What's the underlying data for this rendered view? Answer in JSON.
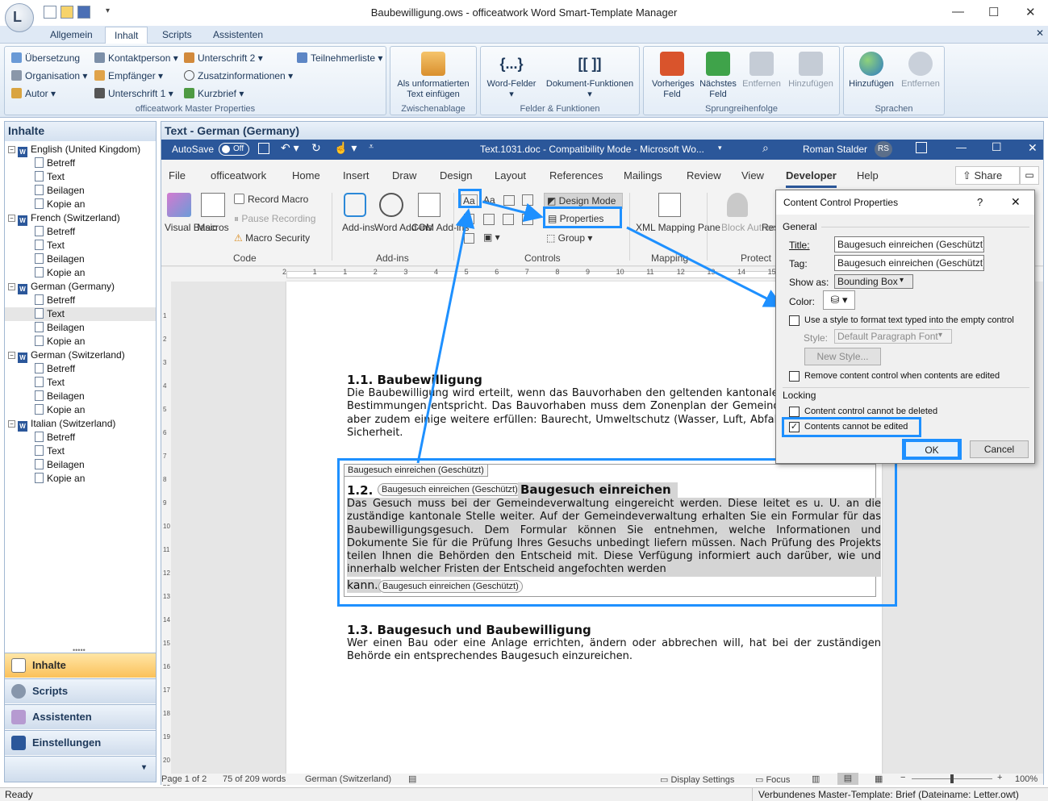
{
  "window": {
    "title": "Baubewilligung.ows - officeatwork Word Smart-Template Manager",
    "app_logo": "L"
  },
  "tabs": [
    "Allgemein",
    "Inhalt",
    "Scripts",
    "Assistenten"
  ],
  "ribbon": {
    "master_properties": {
      "items": [
        "Übersetzung",
        "Kontaktperson",
        "Unterschrift 2",
        "Teilnehmerliste",
        "Organisation",
        "Empfänger",
        "Zusatzinformationen",
        "Autor",
        "Unterschrift 1",
        "Kurzbrief"
      ],
      "label": "officeatwork Master Properties"
    },
    "clipboard": {
      "button": "Als unformatierten Text einfügen",
      "label": "Zwischenablage"
    },
    "fields": {
      "word_fields": "Word-Felder",
      "doc_functions": "Dokument-Funktionen",
      "label": "Felder & Funktionen",
      "word_fields_icon": "{...}",
      "doc_functions_icon": "[[ ]]"
    },
    "jumps": {
      "prev": "Vorheriges Feld",
      "next": "Nächstes Feld",
      "remove": "Entfernen",
      "add": "Hinzufügen",
      "label": "Sprungreihenfolge"
    },
    "languages": {
      "add": "Hinzufügen",
      "remove": "Entfernen",
      "label": "Sprachen"
    }
  },
  "left_panel": {
    "title": "Inhalte",
    "tree": [
      {
        "label": "English (United Kingdom)",
        "children": [
          "Betreff",
          "Text",
          "Beilagen",
          "Kopie an"
        ]
      },
      {
        "label": "French (Switzerland)",
        "children": [
          "Betreff",
          "Text",
          "Beilagen",
          "Kopie an"
        ]
      },
      {
        "label": "German (Germany)",
        "children": [
          "Betreff",
          "Text",
          "Beilagen",
          "Kopie an"
        ]
      },
      {
        "label": "German (Switzerland)",
        "children": [
          "Betreff",
          "Text",
          "Beilagen",
          "Kopie an"
        ]
      },
      {
        "label": "Italian (Switzerland)",
        "children": [
          "Betreff",
          "Text",
          "Beilagen",
          "Kopie an"
        ]
      }
    ],
    "nav": [
      "Inhalte",
      "Scripts",
      "Assistenten",
      "Einstellungen"
    ]
  },
  "word": {
    "header": "Text - German (Germany)",
    "autosave": "AutoSave",
    "autosave_state": "Off",
    "doc_title": "Text.1031.doc  -  Compatibility Mode  -  Microsoft Wo...",
    "user": "Roman Stalder",
    "user_initials": "RS",
    "menu": [
      "File",
      "officeatwork",
      "Home",
      "Insert",
      "Draw",
      "Design",
      "Layout",
      "References",
      "Mailings",
      "Review",
      "View",
      "Developer",
      "Help"
    ],
    "share": "Share",
    "ribbon": {
      "visual_basic": "Visual Basic",
      "macros": "Macros",
      "record_macro": "Record Macro",
      "pause_recording": "Pause Recording",
      "macro_security": "Macro Security",
      "code_label": "Code",
      "addins": "Add-ins",
      "word_addins": "Word Add-ins",
      "com_addins": "COM Add-ins",
      "addins_label": "Add-ins",
      "design_mode": "Design Mode",
      "properties": "Properties",
      "group": "Group",
      "controls_label": "Controls",
      "xml_pane": "XML Mapping Pane",
      "mapping_label": "Mapping",
      "block_authors": "Block Authors",
      "restrict": "Res Edi",
      "protect_label": "Protect",
      "cc_aa_1": "Aa",
      "cc_aa_2": "Aa"
    },
    "ruler_numbers": [
      "2",
      "1",
      "1",
      "2",
      "3",
      "4",
      "5",
      "6",
      "7",
      "8",
      "9",
      "10",
      "11",
      "12",
      "13",
      "14",
      "15",
      "16",
      "17",
      "18"
    ],
    "vruler_numbers": [
      "1",
      "2",
      "3",
      "4",
      "5",
      "6",
      "7",
      "8",
      "9",
      "10",
      "11",
      "12",
      "13",
      "14",
      "15",
      "16",
      "17",
      "18",
      "19",
      "20",
      "21"
    ],
    "document": {
      "h1": "1.1. Baubewilligung",
      "p1": "Die Baubewilligung wird erteilt, wenn das Bauvorhaben den geltenden kantonalen und kommunalen Bestimmungen entspricht. Das Bauvorhaben muss dem Zonenplan der Gemeinde entsprechen, hat aber zudem einige weitere erfüllen: Baurecht, Umweltschutz (Wasser, Luft, Abfall, Lärm), öffentliche Sicherheit.",
      "cc_tag": "Baugesuch einreichen (Geschützt)",
      "h2_num": "1.2.",
      "h2_text": "Baugesuch einreichen",
      "p2": "Das Gesuch muss bei der Gemeindeverwaltung eingereicht werden. Diese leitet es u. U. an die zuständige kantonale Stelle weiter. Auf der Gemeindeverwaltung erhalten Sie ein Formular für das Baubewilligungsgesuch. Dem Formular können Sie entnehmen, welche Informationen und Dokumente Sie für die Prüfung Ihres Gesuchs unbedingt liefern müssen. Nach Prüfung des Projekts teilen Ihnen die Behörden den Entscheid mit. Diese Verfügung informiert auch darüber, wie und innerhalb welcher Fristen der Entscheid angefochten werden",
      "p2_end": "kann.",
      "h3": "1.3. Baugesuch und Baubewilligung",
      "p3": "Wer einen Bau oder eine Anlage errichten, ändern oder abbrechen will, hat bei der zuständigen Behörde ein entsprechendes Baugesuch einzureichen."
    },
    "status": {
      "page": "Page 1 of 2",
      "words": "75 of 209 words",
      "lang": "German (Switzerland)",
      "display": "Display Settings",
      "focus": "Focus",
      "zoom": "100%"
    }
  },
  "dialog": {
    "title": "Content Control Properties",
    "help": "?",
    "general": "General",
    "title_label": "Title:",
    "title_value": "Baugesuch einreichen (Geschützt)",
    "tag_label": "Tag:",
    "tag_value": "Baugesuch einreichen (Geschützt)",
    "show_as_label": "Show as:",
    "show_as_value": "Bounding Box",
    "color_label": "Color:",
    "use_style": "Use a style to format text typed into the empty control",
    "style_label": "Style:",
    "style_value": "Default Paragraph Font",
    "new_style": "New Style...",
    "remove_cc": "Remove content control when contents are edited",
    "locking": "Locking",
    "cannot_delete": "Content control cannot be deleted",
    "cannot_edit": "Contents cannot be edited",
    "ok": "OK",
    "cancel": "Cancel",
    "use_style_checked": false,
    "remove_cc_checked": false,
    "cannot_delete_checked": false,
    "cannot_edit_checked": true
  },
  "statusbar": {
    "left": "Ready",
    "right": "Verbundenes Master-Template: Brief (Dateiname: Letter.owt)"
  },
  "colors": {
    "accent": "#1e90ff",
    "word_blue": "#2b579a",
    "nav_active": "#fbc15a"
  }
}
